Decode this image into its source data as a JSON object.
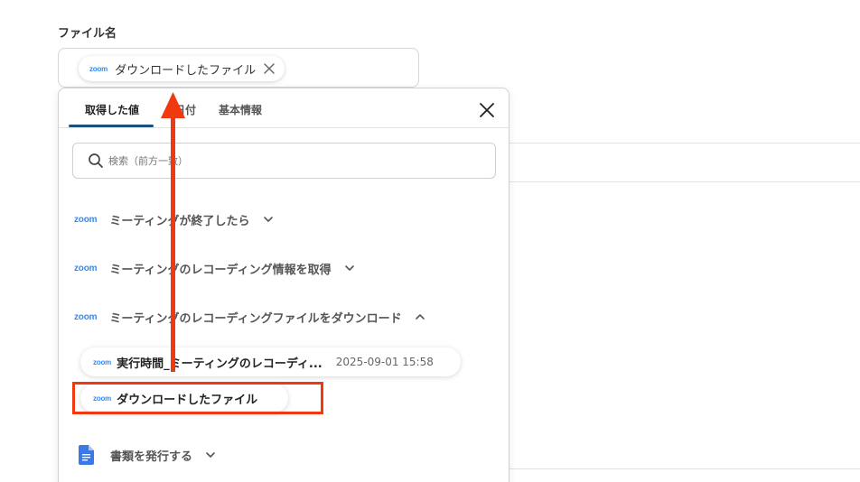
{
  "field": {
    "label": "ファイル名",
    "chip": {
      "logo": "zoom",
      "text": "ダウンロードしたファイル",
      "close_icon": "close-icon"
    }
  },
  "panel": {
    "tabs": [
      {
        "label": "取得した値",
        "active": true
      },
      {
        "label": "日付",
        "active": false
      },
      {
        "label": "基本情報",
        "active": false
      }
    ],
    "close_icon": "close-icon",
    "search": {
      "placeholder": "検索（前方一致）",
      "icon": "search-icon"
    },
    "sections": [
      {
        "logo": "zoom",
        "label": "ミーティングが終了したら",
        "expanded": false
      },
      {
        "logo": "zoom",
        "label": "ミーティングのレコーディング情報を取得",
        "expanded": false
      },
      {
        "logo": "zoom",
        "label": "ミーティングのレコーディングファイルをダウンロード",
        "expanded": true
      },
      {
        "logo": "google-docs-icon",
        "label": "書類を発行する",
        "expanded": false
      }
    ],
    "items": [
      {
        "logo": "zoom",
        "label": "実行時間_ミーティングのレコーディ...",
        "value": "2025-09-01 15:58"
      },
      {
        "logo": "zoom",
        "label": "ダウンロードしたファイル"
      }
    ]
  },
  "annotation": {
    "highlight_color": "#f0390f",
    "arrow_color": "#f0390f"
  },
  "colors": {
    "zoom": "#2d8cff",
    "tab_underline": "#1c4f7c",
    "docs": "#3c78e6"
  }
}
